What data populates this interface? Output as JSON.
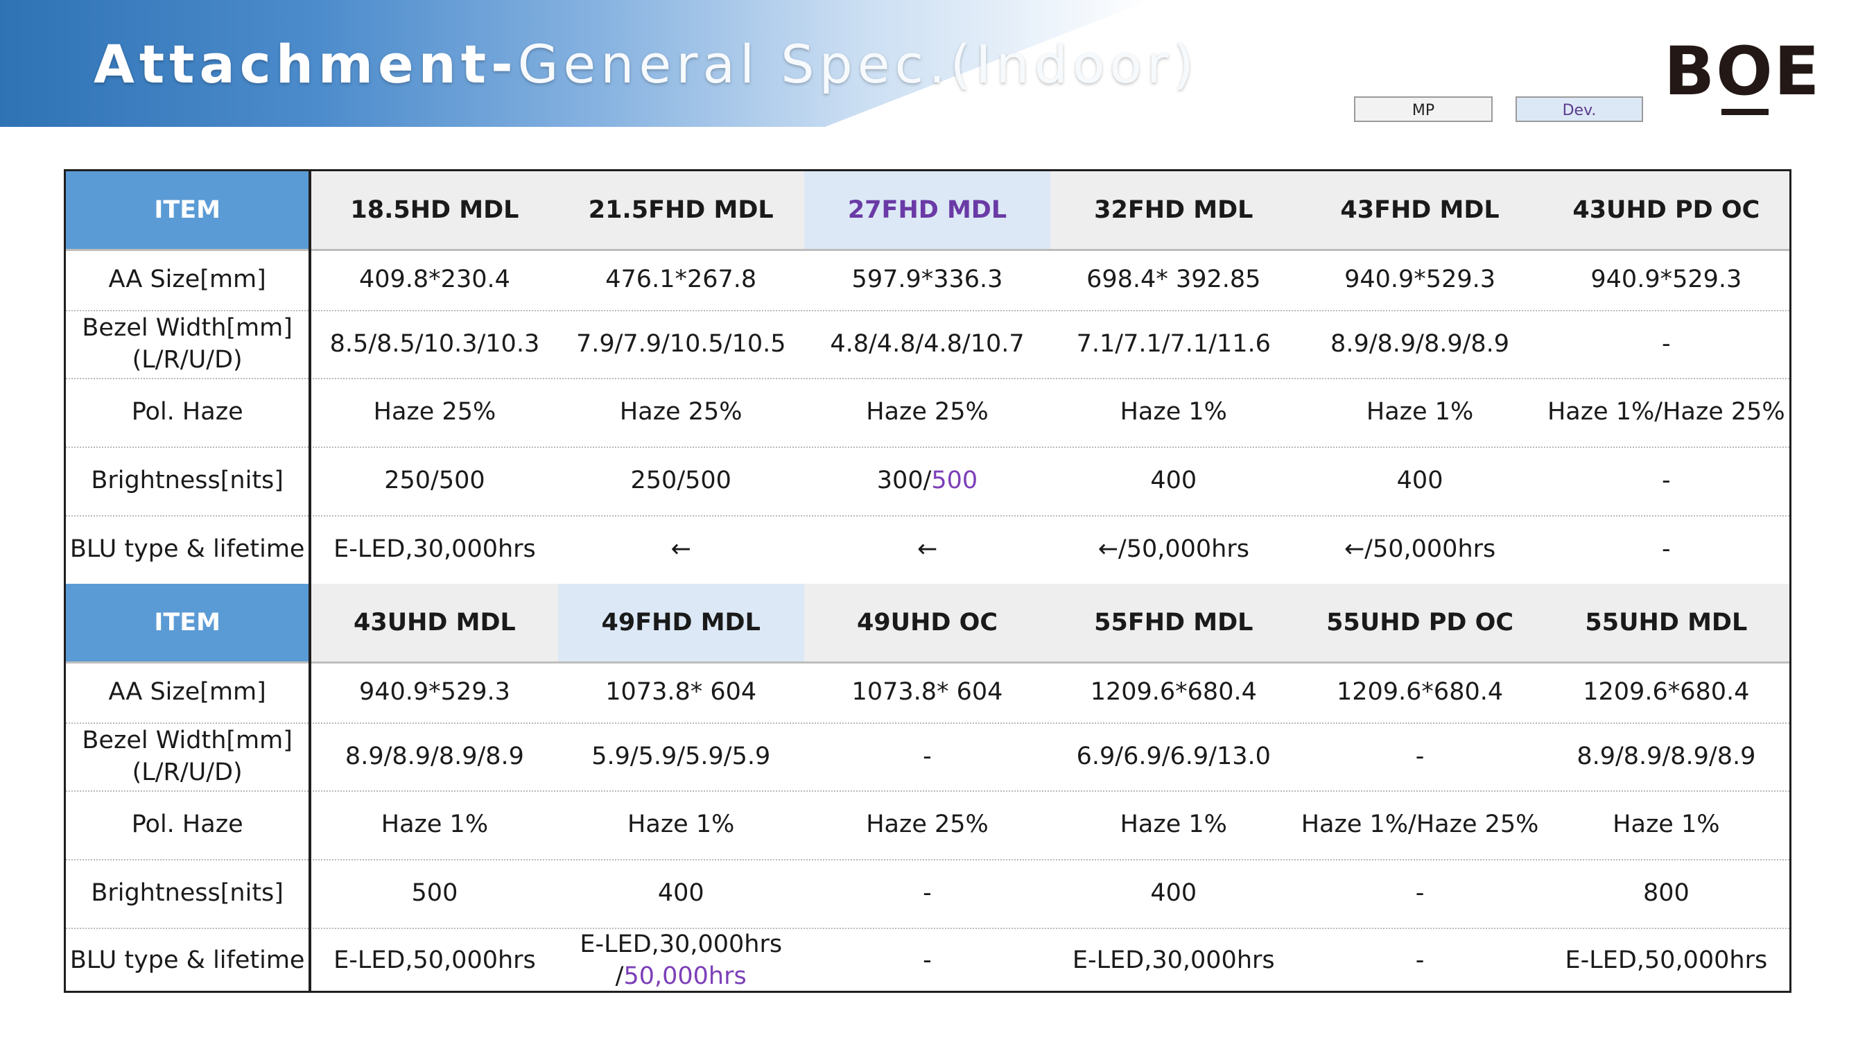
{
  "header": {
    "title_main": "Attachment-",
    "title_sub": "General Spec.(Indoor)",
    "logo": "BOE",
    "legend_mp": "MP",
    "legend_dev": "Dev."
  },
  "colors": {
    "banner": "#2f73b5",
    "item_header": "#5b9bd5",
    "dev_highlight": "#dce8f6",
    "dev_text": "#6a3aa6"
  },
  "table1": {
    "headers": [
      "ITEM",
      "18.5HD MDL",
      "21.5FHD MDL",
      "27FHD MDL",
      "32FHD MDL",
      "43FHD MDL",
      "43UHD PD OC"
    ],
    "rows": [
      [
        "AA Size[mm]",
        "409.8*230.4",
        "476.1*267.8",
        "597.9*336.3",
        "698.4* 392.85",
        "940.9*529.3",
        "940.9*529.3"
      ],
      [
        "Bezel Width[mm]\n(L/R/U/D)",
        "8.5/8.5/10.3/10.3",
        "7.9/7.9/10.5/10.5",
        "4.8/4.8/4.8/10.7",
        "7.1/7.1/7.1/11.6",
        "8.9/8.9/8.9/8.9",
        "-"
      ],
      [
        "Pol. Haze",
        "Haze 25%",
        "Haze 25%",
        "Haze 25%",
        "Haze 1%",
        "Haze 1%",
        "Haze 1%/Haze 25%"
      ],
      [
        "Brightness[nits]",
        "250/500",
        "250/500",
        "300/500",
        "400",
        "400",
        "-"
      ],
      [
        "BLU type & lifetime",
        "E-LED,30,000hrs",
        "←",
        "←",
        "←/50,000hrs",
        "←/50,000hrs",
        "-"
      ]
    ]
  },
  "table2": {
    "headers": [
      "ITEM",
      "43UHD MDL",
      "49FHD MDL",
      "49UHD OC",
      "55FHD MDL",
      "55UHD PD OC",
      "55UHD MDL"
    ],
    "rows": [
      [
        "AA Size[mm]",
        "940.9*529.3",
        "1073.8* 604",
        "1073.8* 604",
        "1209.6*680.4",
        "1209.6*680.4",
        "1209.6*680.4"
      ],
      [
        "Bezel Width[mm]\n(L/R/U/D)",
        "8.9/8.9/8.9/8.9",
        "5.9/5.9/5.9/5.9",
        "-",
        "6.9/6.9/6.9/13.0",
        "-",
        "8.9/8.9/8.9/8.9"
      ],
      [
        "Pol. Haze",
        "Haze 1%",
        "Haze 1%",
        "Haze 25%",
        "Haze 1%",
        "Haze 1%/Haze 25%",
        "Haze 1%"
      ],
      [
        "Brightness[nits]",
        "500",
        "400",
        "-",
        "400",
        "-",
        "800"
      ],
      [
        "BLU type & lifetime",
        "E-LED,50,000hrs",
        "E-LED,30,000hrs\n/50,000hrs",
        "-",
        "E-LED,30,000hrs",
        "-",
        "E-LED,50,000hrs"
      ]
    ]
  }
}
